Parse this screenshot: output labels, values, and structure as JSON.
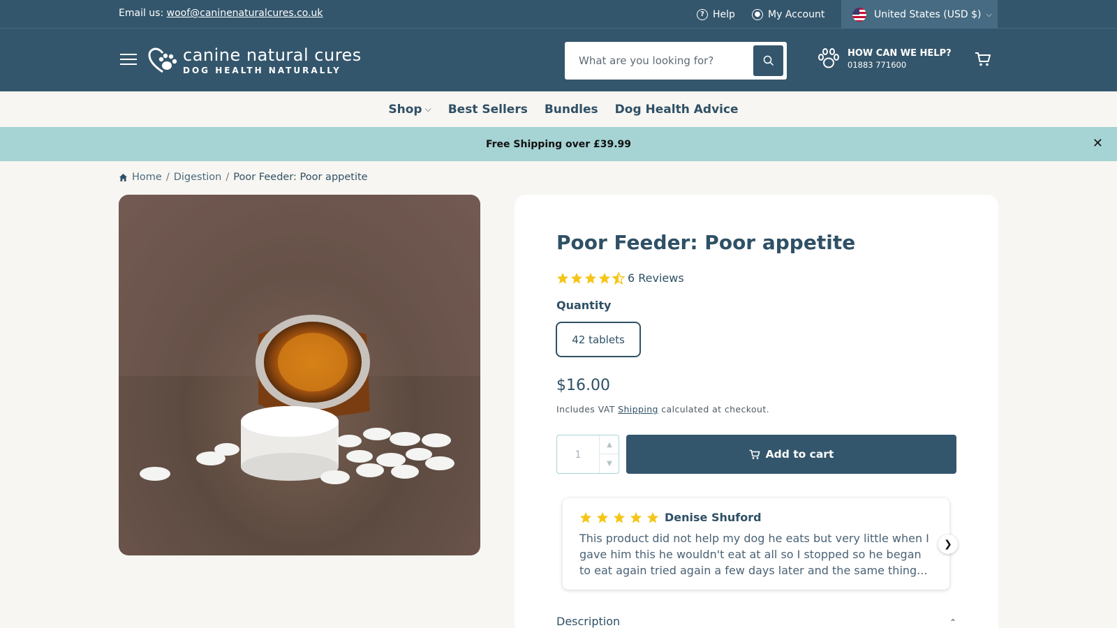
{
  "colors": {
    "header": "#34566c",
    "announce": "#a6d3d4",
    "star": "#f5c518",
    "page_bg": "#f8f6f2"
  },
  "topbar": {
    "email_prefix": "Email us: ",
    "email": "woof@caninenaturalcures.co.uk",
    "help": "Help",
    "account": "My Account",
    "region": "United States (USD $)"
  },
  "header": {
    "logo_line1": "canine natural cures",
    "logo_line2": "DOG HEALTH NATURALLY",
    "search_placeholder": "What are you looking for?",
    "help_title": "HOW CAN WE HELP?",
    "help_phone": "01883 771600"
  },
  "nav": {
    "items": [
      "Shop",
      "Best Sellers",
      "Bundles",
      "Dog Health Advice"
    ]
  },
  "announcement": {
    "text": "Free Shipping over £39.99"
  },
  "breadcrumb": {
    "home": "Home",
    "category": "Digestion",
    "current": "Poor Feeder: Poor appetite"
  },
  "product": {
    "title": "Poor Feeder: Poor appetite",
    "rating": 4.5,
    "reviews_label": "6 Reviews",
    "quantity_label": "Quantity",
    "variant": "42 tablets",
    "price": "$16.00",
    "tax_prefix": "Includes VAT ",
    "tax_link": "Shipping",
    "tax_suffix": " calculated at checkout.",
    "qty_value": "1",
    "add_to_cart": "Add to cart",
    "description_label": "Description"
  },
  "review": {
    "rating": 5,
    "author": "Denise Shuford",
    "text": "This product did not help my dog he eats but very little when I gave him this he wouldn't eat at all so I stopped so he began to eat again tried again a few days later and the same thing..."
  }
}
